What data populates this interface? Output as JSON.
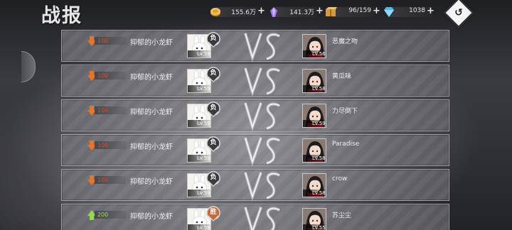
{
  "header": {
    "title": "战报"
  },
  "resources": [
    {
      "name": "gold",
      "icon": "gold-coin-icon",
      "value": "155.6万",
      "color": "#e9b84a"
    },
    {
      "name": "crystal",
      "icon": "purple-crystal-icon",
      "value": "141.3万",
      "color": "#b38cf2"
    },
    {
      "name": "stamina",
      "icon": "crate-icon",
      "value": "96/159",
      "color": "#e4b35c"
    },
    {
      "name": "diamond",
      "icon": "blue-diamond-icon",
      "value": "1038",
      "color": "#5fc6f0"
    }
  ],
  "back_button": {
    "icon": "return-arrow-icon",
    "glyph": "↺"
  },
  "colors": {
    "loss_delta": "#d94a2c",
    "win_delta": "#9ee05a",
    "loss_badge": "#3b3b3f",
    "win_badge": "#c46a38"
  },
  "battles": [
    {
      "delta": "100",
      "direction": "down",
      "player": "抑郁的小龙虾",
      "player_level": "Lv.59",
      "result": "负",
      "opponent": "恶魔之吻",
      "opponent_level": "Lv.56"
    },
    {
      "delta": "100",
      "direction": "down",
      "player": "抑郁的小龙虾",
      "player_level": "Lv.59",
      "result": "负",
      "opponent": "黄瓜味",
      "opponent_level": "Lv.58"
    },
    {
      "delta": "100",
      "direction": "down",
      "player": "抑郁的小龙虾",
      "player_level": "Lv.59",
      "result": "负",
      "opponent": "力尽倒下",
      "opponent_level": "Lv.59"
    },
    {
      "delta": "100",
      "direction": "down",
      "player": "抑郁的小龙虾",
      "player_level": "Lv.59",
      "result": "负",
      "opponent": "Paradise",
      "opponent_level": "Lv.58"
    },
    {
      "delta": "100",
      "direction": "down",
      "player": "抑郁的小龙虾",
      "player_level": "Lv.59",
      "result": "负",
      "opponent": "crow",
      "opponent_level": "Lv.58"
    },
    {
      "delta": "200",
      "direction": "up",
      "player": "抑郁的小龙虾",
      "player_level": "Lv.59",
      "result": "胜",
      "opponent": "苏尘尘",
      "opponent_level": "Lv.55"
    }
  ]
}
